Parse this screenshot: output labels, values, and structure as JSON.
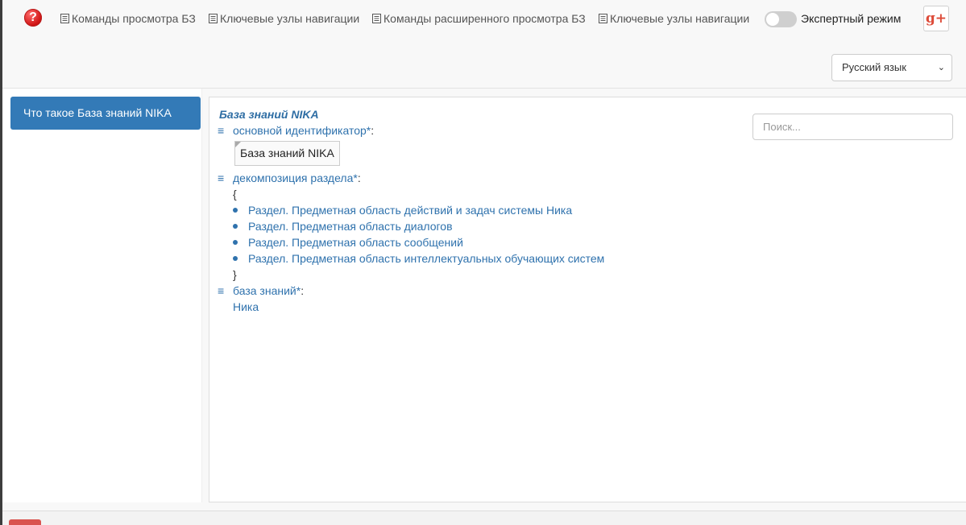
{
  "header": {
    "help_icon": "help-icon",
    "menu": [
      {
        "label": "Команды просмотра БЗ",
        "icon": "menu-doc-icon"
      },
      {
        "label": "Ключевые узлы навигации",
        "icon": "menu-doc-icon"
      },
      {
        "label": "Команды расширенного просмотра БЗ",
        "icon": "menu-doc-icon"
      },
      {
        "label": "Ключевые узлы навигации",
        "icon": "menu-doc-icon"
      }
    ],
    "expert_mode_label": "Экспертный режим",
    "expert_mode_on": false,
    "gplus_label": "g+",
    "language_selected": "Русский язык"
  },
  "sidebar": {
    "items": [
      {
        "label": "Что такое База знаний NIKA",
        "active": true
      }
    ]
  },
  "main": {
    "search_placeholder": "Поиск...",
    "title": "База знаний NIKA",
    "relations": [
      {
        "label": "основной идентификатор",
        "star": "*",
        "colon": ":"
      },
      {
        "label": "декомпозиция раздела",
        "star": "*",
        "colon": ":"
      },
      {
        "label": "база знаний",
        "star": "*",
        "colon": ":"
      }
    ],
    "identifier_value": "База знаний NIKA",
    "brace_open": "{",
    "brace_close": "}",
    "decomposition_items": [
      "Раздел. Предметная область действий и задач системы Ника",
      "Раздел. Предметная область диалогов",
      "Раздел. Предметная область сообщений",
      "Раздел. Предметная область интеллектуальных обучающих систем"
    ],
    "knowledge_base_value": "Ника"
  },
  "colors": {
    "accent": "#337ab7",
    "link": "#2f72ad",
    "help_red": "#d11515",
    "gplus_red": "#dd4b39",
    "footer_btn": "#d9534f"
  }
}
